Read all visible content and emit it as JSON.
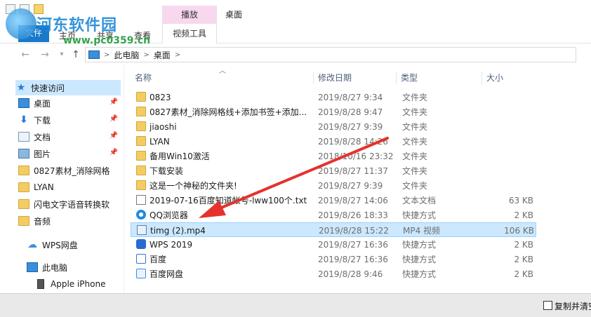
{
  "watermark": {
    "title": "河东软件园",
    "url": "www.pc0359.cn"
  },
  "ribbon": {
    "file_tab": "文件",
    "home_tab": "主页",
    "share_tab": "共享",
    "view_tab": "查看",
    "context_group": "播放",
    "context_tab": "视频工具",
    "window_title": "桌面"
  },
  "address": {
    "crumbs": [
      "此电脑",
      "桌面"
    ],
    "sep": ">"
  },
  "nav": {
    "quick_access": "快速访问",
    "items": [
      {
        "label": "桌面",
        "icon": "desktop-icon",
        "pinned": true
      },
      {
        "label": "下载",
        "icon": "download-icon",
        "pinned": true
      },
      {
        "label": "文档",
        "icon": "document-icon",
        "pinned": true
      },
      {
        "label": "图片",
        "icon": "picture-icon",
        "pinned": true
      },
      {
        "label": "0827素材_消除网格",
        "icon": "folder-icon",
        "pinned": false
      },
      {
        "label": "LYAN",
        "icon": "folder-icon",
        "pinned": false
      },
      {
        "label": "闪电文字语音转换软",
        "icon": "folder-icon",
        "pinned": false
      },
      {
        "label": "音频",
        "icon": "folder-icon",
        "pinned": false
      }
    ],
    "wps_cloud": "WPS网盘",
    "this_pc": "此电脑",
    "iphone": "Apple iPhone"
  },
  "columns": {
    "name": "名称",
    "date": "修改日期",
    "type": "类型",
    "size": "大小"
  },
  "files": [
    {
      "name": "0823",
      "date": "2019/8/27 9:34",
      "type": "文件夹",
      "size": "",
      "icon": "folder-icon"
    },
    {
      "name": "0827素材_消除网格线+添加书签+添加...",
      "date": "2019/8/28 9:47",
      "type": "文件夹",
      "size": "",
      "icon": "folder-icon"
    },
    {
      "name": "jiaoshi",
      "date": "2019/8/27 9:39",
      "type": "文件夹",
      "size": "",
      "icon": "folder-icon"
    },
    {
      "name": "LYAN",
      "date": "2019/8/28 14:26",
      "type": "文件夹",
      "size": "",
      "icon": "folder-icon"
    },
    {
      "name": "备用Win10激活",
      "date": "2018/10/16 23:32",
      "type": "文件夹",
      "size": "",
      "icon": "folder-icon"
    },
    {
      "name": "下载安装",
      "date": "2019/8/27 11:37",
      "type": "文件夹",
      "size": "",
      "icon": "folder-icon"
    },
    {
      "name": "这是一个神秘的文件夹!",
      "date": "2019/8/27 9:39",
      "type": "文件夹",
      "size": "",
      "icon": "folder-icon"
    },
    {
      "name": "2019-07-16百度知道帐号-lww100个.txt",
      "date": "2019/8/27 14:06",
      "type": "文本文档",
      "size": "63 KB",
      "icon": "text-file-icon"
    },
    {
      "name": "QQ浏览器",
      "date": "2019/8/26 18:33",
      "type": "快捷方式",
      "size": "2 KB",
      "icon": "qq-browser-icon"
    },
    {
      "name": "timg (2).mp4",
      "date": "2019/8/28 15:22",
      "type": "MP4 视频",
      "size": "106 KB",
      "icon": "video-file-icon",
      "selected": true
    },
    {
      "name": "WPS 2019",
      "date": "2019/8/27 16:36",
      "type": "快捷方式",
      "size": "2 KB",
      "icon": "wps-icon"
    },
    {
      "name": "百度",
      "date": "2019/8/27 16:36",
      "type": "快捷方式",
      "size": "2 KB",
      "icon": "baidu-icon"
    },
    {
      "name": "百度网盘",
      "date": "2019/8/28 9:46",
      "type": "快捷方式",
      "size": "2 KB",
      "icon": "baidu-netdisk-icon"
    }
  ],
  "status": {
    "checkbox_label": "复制并清空"
  },
  "colors": {
    "accent": "#1979ca",
    "selection": "#cce8ff",
    "arrow": "#e5322d",
    "context_tab": "#f7d8ee"
  }
}
